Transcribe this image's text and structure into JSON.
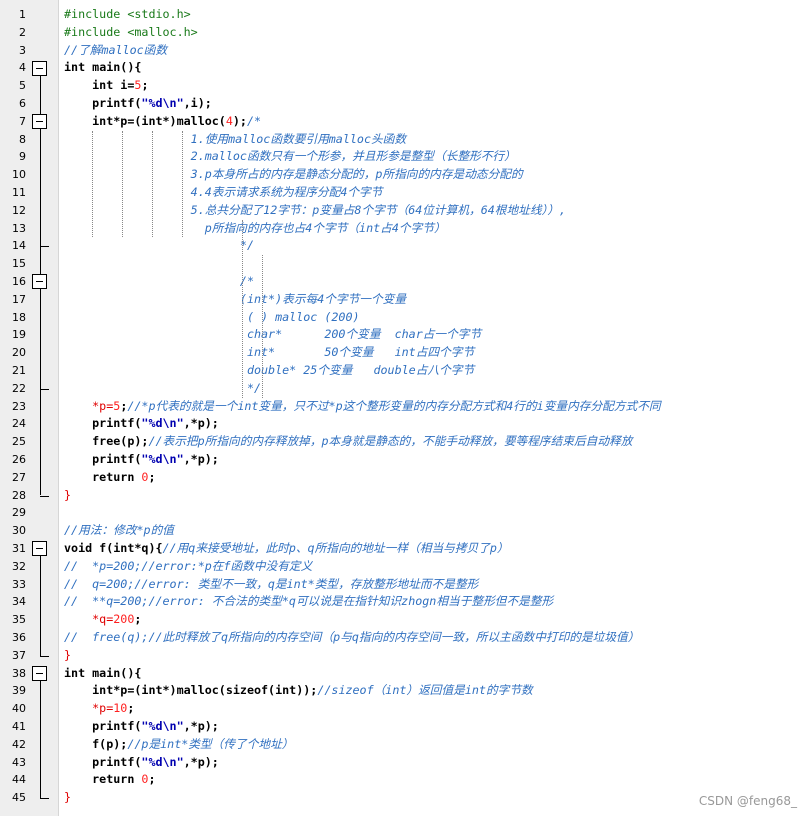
{
  "editor": {
    "line_numbers": [
      "1",
      "2",
      "3",
      "4",
      "5",
      "6",
      "7",
      "8",
      "9",
      "10",
      "11",
      "12",
      "13",
      "14",
      "15",
      "16",
      "17",
      "18",
      "19",
      "20",
      "21",
      "22",
      "23",
      "24",
      "25",
      "26",
      "27",
      "28",
      "29",
      "30",
      "31",
      "32",
      "33",
      "34",
      "35",
      "36",
      "37",
      "38",
      "39",
      "40",
      "41",
      "42",
      "43",
      "44",
      "45"
    ],
    "lines": [
      [
        {
          "t": "#include <stdio.h>",
          "c": "pp"
        }
      ],
      [
        {
          "t": "#include <malloc.h>",
          "c": "pp"
        }
      ],
      [
        {
          "t": "//了解malloc函数",
          "c": "cm"
        }
      ],
      [
        {
          "t": "int",
          "c": "kw"
        },
        {
          "t": " main(){",
          "c": "kw"
        }
      ],
      [
        {
          "t": "    int",
          "c": "kw"
        },
        {
          "t": " i=",
          "c": "kw"
        },
        {
          "t": "5",
          "c": "num"
        },
        {
          "t": ";",
          "c": "kw"
        }
      ],
      [
        {
          "t": "    printf(",
          "c": "kw"
        },
        {
          "t": "\"%d\\n\"",
          "c": "str"
        },
        {
          "t": ",i);",
          "c": "kw"
        }
      ],
      [
        {
          "t": "    int*p=(int*)malloc(",
          "c": "kw"
        },
        {
          "t": "4",
          "c": "num"
        },
        {
          "t": ");",
          "c": "kw"
        },
        {
          "t": "/*",
          "c": "cm"
        }
      ],
      [
        {
          "t": "                  1.使用malloc函数要引用malloc头函数",
          "c": "cm"
        }
      ],
      [
        {
          "t": "                  2.malloc函数只有一个形参，并且形参是整型（长整形不行）",
          "c": "cm"
        }
      ],
      [
        {
          "t": "                  3.p本身所占的内存是静态分配的，p所指向的内存是动态分配的",
          "c": "cm"
        }
      ],
      [
        {
          "t": "                  4.4表示请求系统为程序分配4个字节",
          "c": "cm"
        }
      ],
      [
        {
          "t": "                  5.总共分配了12字节：p变量占8个字节（64位计算机，64根地址线））,",
          "c": "cm"
        }
      ],
      [
        {
          "t": "                    p所指向的内存也占4个字节（int占4个字节）",
          "c": "cm"
        }
      ],
      [
        {
          "t": "                         */",
          "c": "cm"
        }
      ],
      [
        {
          "t": "",
          "c": "cm"
        }
      ],
      [
        {
          "t": "                         /*",
          "c": "cm"
        }
      ],
      [
        {
          "t": "                         (int*)表示每4个字节一个变量",
          "c": "cm"
        }
      ],
      [
        {
          "t": "                          ( ) malloc (200)",
          "c": "cm"
        }
      ],
      [
        {
          "t": "                          char*      200个变量  char占一个字节",
          "c": "cm"
        }
      ],
      [
        {
          "t": "                          int*       50个变量   int占四个字节",
          "c": "cm"
        }
      ],
      [
        {
          "t": "                          double* 25个变量   double占八个字节",
          "c": "cm"
        }
      ],
      [
        {
          "t": "                          */",
          "c": "cm"
        }
      ],
      [
        {
          "t": "    *p=",
          "c": "red"
        },
        {
          "t": "5",
          "c": "num"
        },
        {
          "t": ";",
          "c": "kw"
        },
        {
          "t": "//*p代表的就是一个int变量，只不过*p这个整形变量的内存分配方式和4行的i变量内存分配方式不同",
          "c": "cm"
        }
      ],
      [
        {
          "t": "    printf(",
          "c": "kw"
        },
        {
          "t": "\"%d\\n\"",
          "c": "str"
        },
        {
          "t": ",*p);",
          "c": "kw"
        }
      ],
      [
        {
          "t": "    free(p);",
          "c": "kw"
        },
        {
          "t": "//表示把p所指向的内存释放掉，p本身就是静态的，不能手动释放，要等程序结束后自动释放",
          "c": "cm"
        }
      ],
      [
        {
          "t": "    printf(",
          "c": "kw"
        },
        {
          "t": "\"%d\\n\"",
          "c": "str"
        },
        {
          "t": ",*p);",
          "c": "kw"
        }
      ],
      [
        {
          "t": "    return ",
          "c": "kw"
        },
        {
          "t": "0",
          "c": "num"
        },
        {
          "t": ";",
          "c": "kw"
        }
      ],
      [
        {
          "t": "}",
          "c": "red"
        }
      ],
      [
        {
          "t": "",
          "c": "kw"
        }
      ],
      [
        {
          "t": "//用法：修改*p的值",
          "c": "cm"
        }
      ],
      [
        {
          "t": "void f(int*q){",
          "c": "kw"
        },
        {
          "t": "//用q来接受地址，此时p、q所指向的地址一样（相当与拷贝了p）",
          "c": "cm"
        }
      ],
      [
        {
          "t": "//  *p=200;//error:*p在f函数中没有定义",
          "c": "cm"
        }
      ],
      [
        {
          "t": "//  q=200;//error: 类型不一致，q是int*类型，存放整形地址而不是整形",
          "c": "cm"
        }
      ],
      [
        {
          "t": "//  **q=200;//error: 不合法的类型*q可以说是在指针知识zhogn相当于整形但不是整形",
          "c": "cm"
        }
      ],
      [
        {
          "t": "    *q=",
          "c": "red"
        },
        {
          "t": "200",
          "c": "num"
        },
        {
          "t": ";",
          "c": "kw"
        }
      ],
      [
        {
          "t": "//  free(q);//此时释放了q所指向的内存空间（p与q指向的内存空间一致，所以主函数中打印的是垃圾值）",
          "c": "cm"
        }
      ],
      [
        {
          "t": "}",
          "c": "red"
        }
      ],
      [
        {
          "t": "int main(){",
          "c": "kw"
        }
      ],
      [
        {
          "t": "    int*p=(int*)malloc(sizeof(int));",
          "c": "kw"
        },
        {
          "t": "//sizeof（int）返回值是int的字节数",
          "c": "cm"
        }
      ],
      [
        {
          "t": "    *p=",
          "c": "red"
        },
        {
          "t": "10",
          "c": "num"
        },
        {
          "t": ";",
          "c": "kw"
        }
      ],
      [
        {
          "t": "    printf(",
          "c": "kw"
        },
        {
          "t": "\"%d\\n\"",
          "c": "str"
        },
        {
          "t": ",*p);",
          "c": "kw"
        }
      ],
      [
        {
          "t": "    f(p);",
          "c": "kw"
        },
        {
          "t": "//p是int*类型（传了个地址）",
          "c": "cm"
        }
      ],
      [
        {
          "t": "    printf(",
          "c": "kw"
        },
        {
          "t": "\"%d\\n\"",
          "c": "str"
        },
        {
          "t": ",*p);",
          "c": "kw"
        }
      ],
      [
        {
          "t": "    return ",
          "c": "kw"
        },
        {
          "t": "0",
          "c": "num"
        },
        {
          "t": ";",
          "c": "kw"
        }
      ],
      [
        {
          "t": "}",
          "c": "red"
        }
      ]
    ]
  },
  "watermark": "CSDN @feng68_"
}
